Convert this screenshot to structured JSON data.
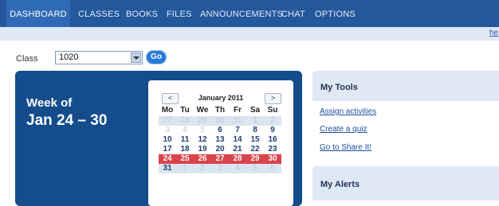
{
  "nav": {
    "tabs": [
      "DASHBOARD",
      "CLASSES",
      "BOOKS",
      "FILES",
      "ANNOUNCEMENTS",
      "CHAT",
      "OPTIONS"
    ],
    "help_text": "he"
  },
  "class_selector": {
    "label": "Class",
    "value": "1020",
    "go_label": "Go"
  },
  "week": {
    "label": "Week of",
    "range": "Jan 24 – 30"
  },
  "calendar": {
    "prev_label": "<",
    "next_label": ">",
    "month_title": "January 2011",
    "weekdays": [
      "Mo",
      "Tu",
      "We",
      "Th",
      "Fr",
      "Sa",
      "Su"
    ],
    "weeks": [
      [
        "27",
        "28",
        "29",
        "30",
        "31",
        "1",
        "2"
      ],
      [
        "3",
        "4",
        "5",
        "6",
        "7",
        "8",
        "9"
      ],
      [
        "10",
        "11",
        "12",
        "13",
        "14",
        "15",
        "16"
      ],
      [
        "17",
        "18",
        "19",
        "20",
        "21",
        "22",
        "23"
      ],
      [
        "24",
        "25",
        "26",
        "27",
        "28",
        "29",
        "30"
      ],
      [
        "31",
        "1",
        "2",
        "3",
        "4",
        "5",
        "6"
      ]
    ]
  },
  "tools": {
    "title": "My Tools",
    "links": [
      "Assign activities",
      "Create a quiz",
      "Go to Share It!"
    ]
  },
  "alerts": {
    "title": "My Alerts"
  }
}
